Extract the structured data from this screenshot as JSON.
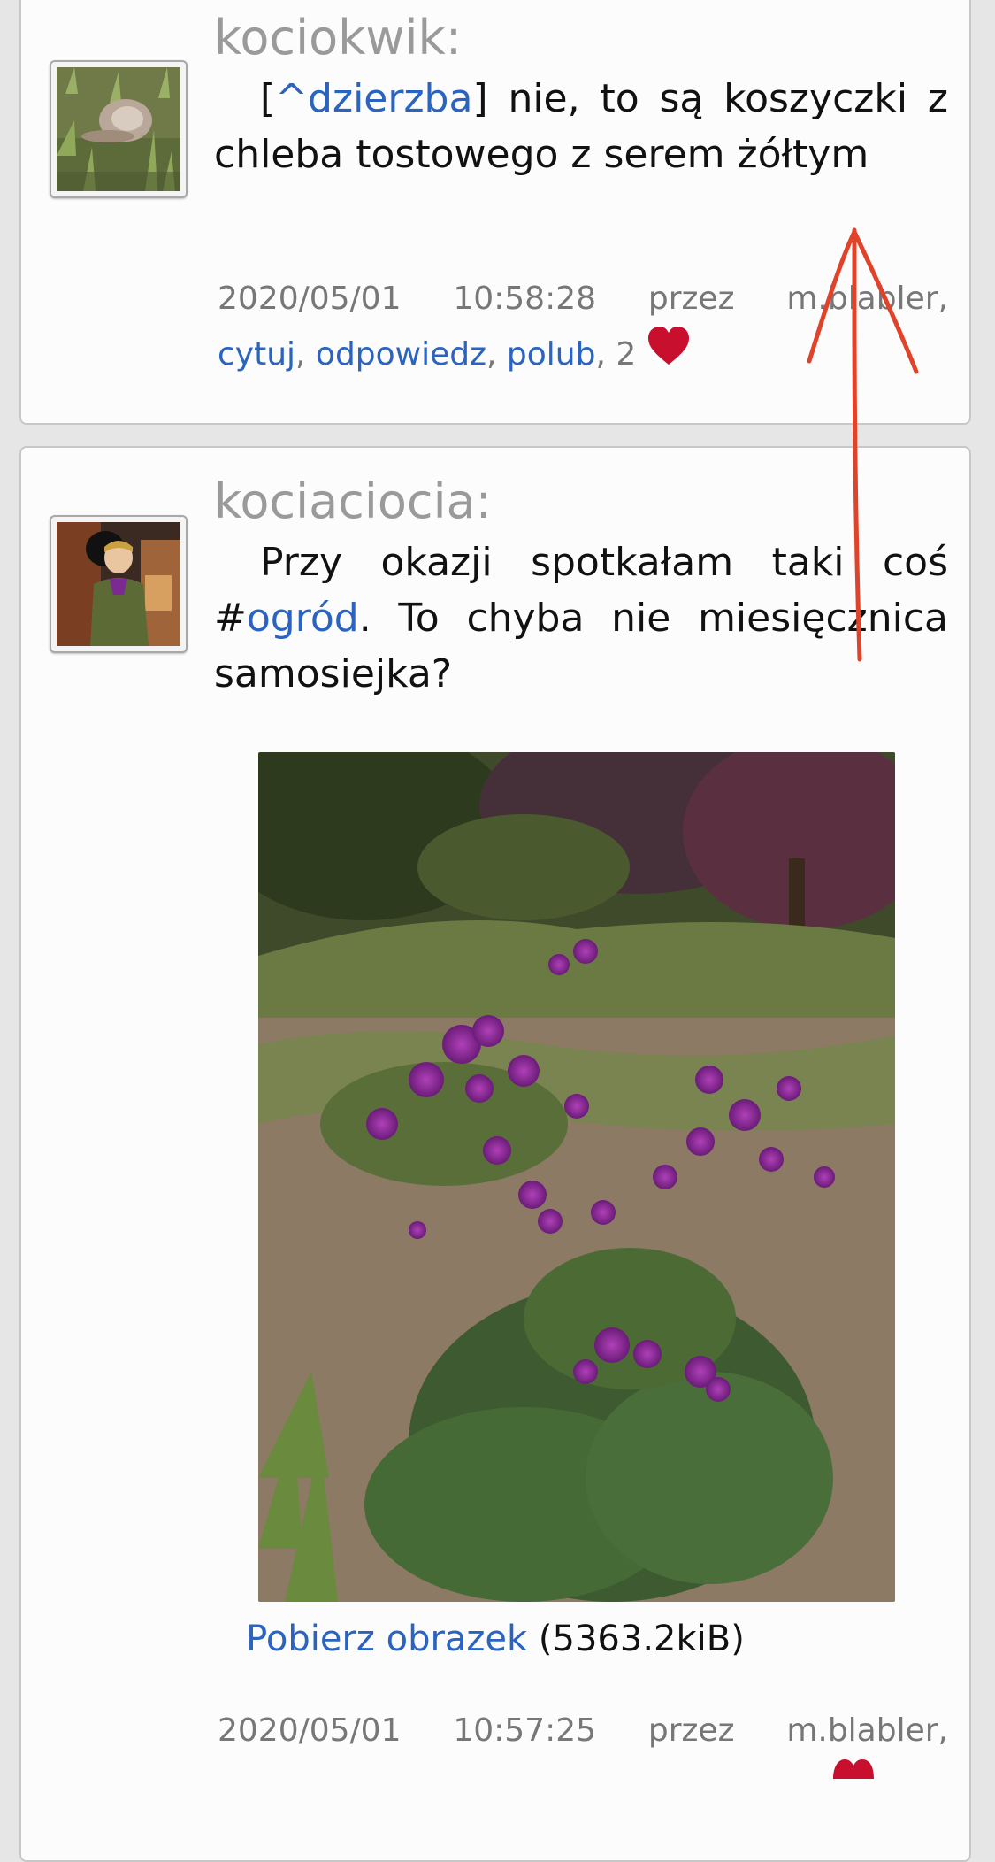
{
  "posts": [
    {
      "username": "kociokwik:",
      "reply_open": "[",
      "reply_link": "^dzierzba",
      "reply_close": "]",
      "body_text": " nie, to są koszyczki z chleba tostowego z serem żółtym",
      "date": "2020/05/01",
      "time": "10:58:28",
      "by_label": "przez",
      "author": "m.blabler,",
      "actions": [
        "cytuj",
        "odpowiedz",
        "polub"
      ],
      "like_count": "2"
    },
    {
      "username": "kociaciocia:",
      "text_before": "Przy okazji spotkałam taki coś ",
      "hash": "#",
      "hashtag": "ogród",
      "text_after": ". To chyba nie miesięcznica samosiejka?",
      "download_link": "Pobierz obrazek",
      "file_size": "(5363.2kiB)",
      "date": "2020/05/01",
      "time": "10:57:25",
      "by_label": "przez",
      "author": "m.blabler,"
    }
  ],
  "colors": {
    "link": "#2a64c0",
    "meta": "#777777",
    "username": "#9a9a9a",
    "heart": "#c8102e",
    "annotation": "#e0432a"
  },
  "icons": [
    "heart-icon",
    "annotation-arrow"
  ]
}
